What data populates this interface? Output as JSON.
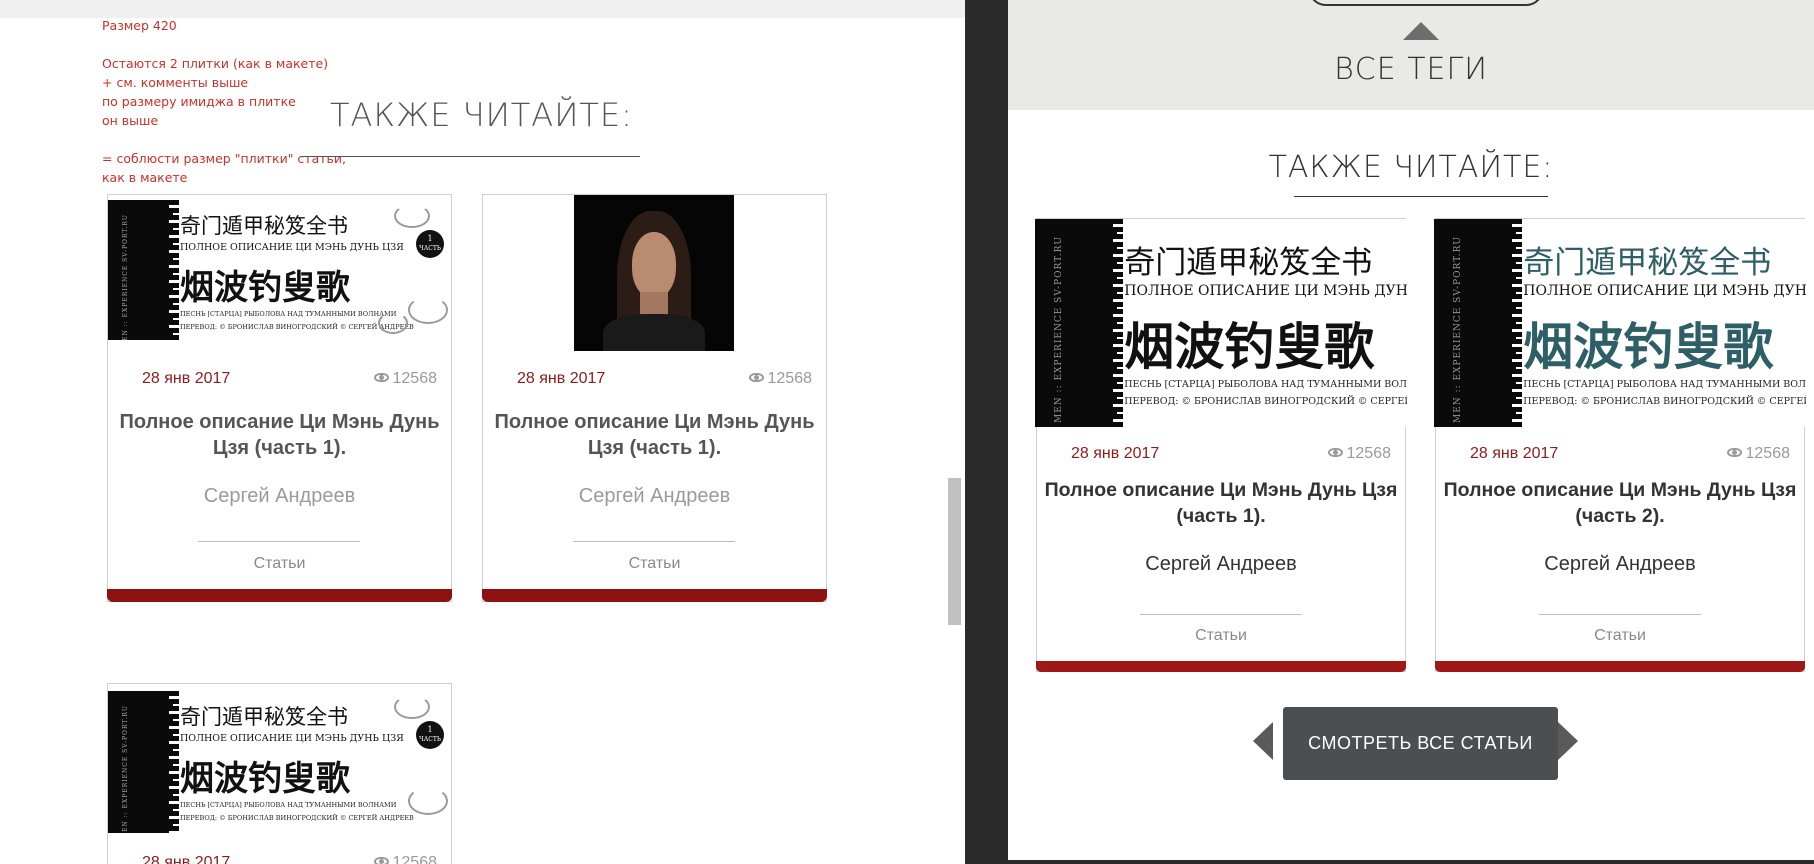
{
  "notes": [
    "Размер 420",
    "",
    "Остаются 2 плитки (как в макете)",
    "+ см. комменты выше",
    "по размеру имиджа в плитке",
    "он выше",
    "",
    "= соблюсти размер \"плитки\" статьи,",
    "как в макете"
  ],
  "left": {
    "heading": "ТАКЖЕ ЧИТАЙТЕ:",
    "cards": [
      {
        "date": "28 янв 2017",
        "views": "12568",
        "title": "Полное описание Ци Мэнь Дунь Цзя (часть 1).",
        "author": "Сергей Андреев",
        "category": "Статьи"
      },
      {
        "date": "28 янв 2017",
        "views": "12568",
        "title": "Полное описание Ци Мэнь Дунь Цзя (часть 1).",
        "author": "Сергей Андреев",
        "category": "Статьи"
      },
      {
        "date": "28 янв 2017",
        "views": "12568"
      }
    ]
  },
  "cover": {
    "vertical": "QI MEN :: EXPERIENCE   SV-PORT.RU",
    "chinese_line1": "奇门遁甲秘笈全书",
    "russian_line1": "ПОЛНОЕ ОПИСАНИЕ ЦИ МЭНЬ ДУНЬ ЦЗЯ",
    "chinese_line2": "烟波钓叟歌",
    "russian_line2": "ПЕСНЬ [СТАРЦА] РЫБОЛОВА НАД ТУМАННЫМИ ВОЛНАМИ",
    "russian_line3": "ПЕРЕВОД: © БРОНИСЛАВ ВИНОГРОДСКИЙ  © СЕРГЕЙ АНДРЕЕВ",
    "badge_number": "1",
    "badge_label": "ЧАСТЬ"
  },
  "right": {
    "tags_label": "ВСЕ ТЕГИ",
    "heading": "ТАКЖЕ ЧИТАЙТЕ:",
    "cards": [
      {
        "date": "28 янв 2017",
        "views": "12568",
        "title": "Полное описание Ци Мэнь Дунь Цзя (часть 1).",
        "author": "Сергей Андреев",
        "category": "Статьи"
      },
      {
        "date": "28 янв 2017",
        "views": "12568",
        "title": "Полное описание Ци Мэнь Дунь Цзя (часть 2).",
        "author": "Сергей Андреев",
        "category": "Статьи"
      }
    ],
    "all_button": "СМОТРЕТЬ ВСЕ СТАТЬИ"
  },
  "colors": {
    "accent_red": "#8e1111",
    "date_red": "#8e1b1b",
    "note_red": "#c8312a",
    "button_gray": "#4b4f51",
    "teal_chinese": "#2e5f66"
  },
  "icons": [
    "eye-icon",
    "caret-up-icon",
    "arrow-left-icon",
    "arrow-right-icon"
  ]
}
